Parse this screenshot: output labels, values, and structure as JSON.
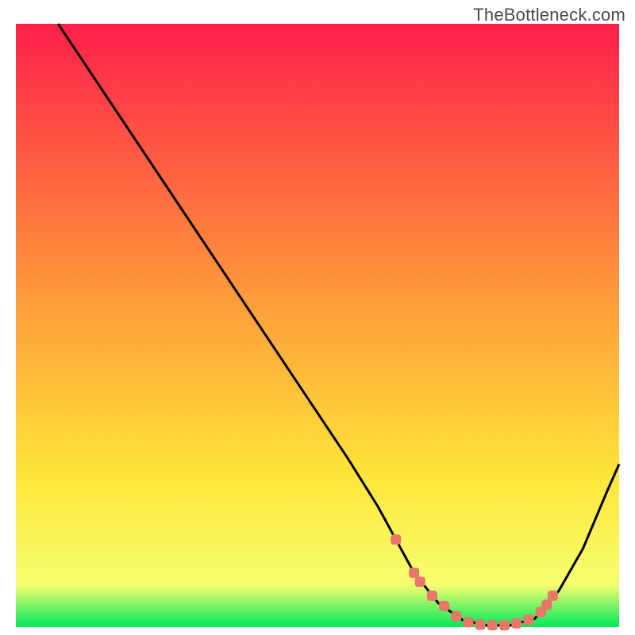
{
  "watermark": "TheBottleneck.com",
  "colors": {
    "gradient_top": "#ff1f4a",
    "gradient_mid": "#ffe63a",
    "gradient_bottom": "#00e85a",
    "curve": "#000000",
    "marker": "#e9756b",
    "background": "#ffffff"
  },
  "chart_data": {
    "type": "line",
    "title": "",
    "xlabel": "",
    "ylabel": "",
    "xlim": [
      0,
      100
    ],
    "ylim": [
      0,
      100
    ],
    "grid": false,
    "curve_description": "Bottleneck percentage curve: starts at 100% at x≈7, descends roughly linearly to a broad minimum near 0% between x≈67 and x≈86, then rises again toward ~27% at x=100.",
    "series": [
      {
        "name": "bottleneck-curve",
        "x": [
          7,
          10,
          15,
          20,
          25,
          30,
          35,
          40,
          45,
          50,
          55,
          60,
          63,
          66,
          70,
          74,
          78,
          82,
          86,
          90,
          94,
          98,
          100
        ],
        "values": [
          100,
          95.5,
          88.0,
          80.5,
          73.0,
          65.5,
          58.0,
          50.5,
          43.0,
          35.5,
          28.0,
          20.0,
          14.5,
          9.0,
          4.0,
          1.2,
          0.3,
          0.3,
          1.4,
          6.0,
          13.0,
          22.5,
          27.0
        ]
      }
    ],
    "markers": {
      "name": "highlighted-points",
      "x": [
        63,
        66,
        67,
        69,
        71,
        73,
        75,
        77,
        79,
        81,
        83,
        85,
        87,
        88,
        89
      ],
      "values": [
        14.5,
        9.0,
        7.5,
        5.2,
        3.5,
        1.8,
        0.8,
        0.4,
        0.3,
        0.3,
        0.6,
        1.2,
        2.5,
        3.7,
        5.2
      ]
    }
  }
}
